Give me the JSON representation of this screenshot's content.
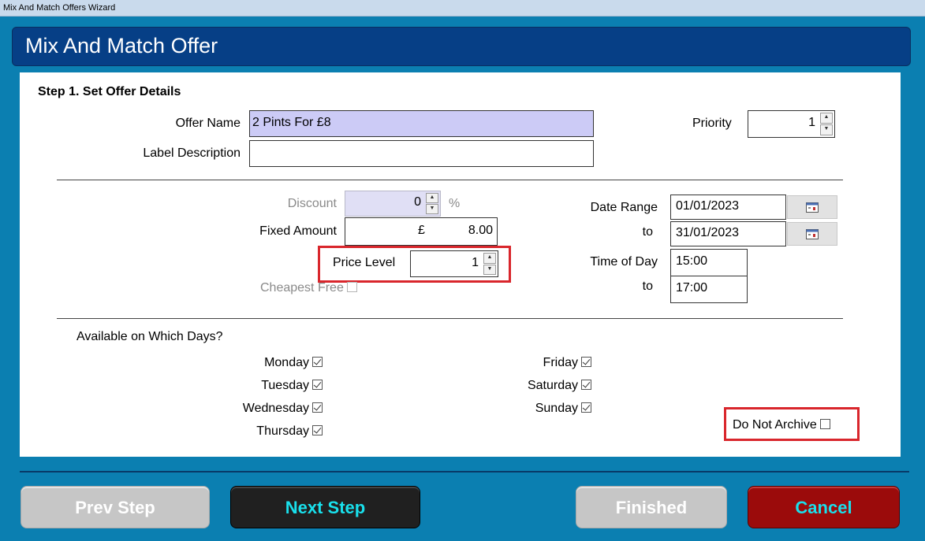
{
  "window": {
    "title": "Mix And Match Offers Wizard"
  },
  "header": {
    "title": "Mix And Match Offer"
  },
  "step": {
    "title": "Step 1.  Set Offer Details"
  },
  "offer_name": {
    "label": "Offer Name",
    "value": "2 Pints For £8"
  },
  "label_description": {
    "label": "Label Description",
    "value": ""
  },
  "priority": {
    "label": "Priority",
    "value": "1"
  },
  "discount": {
    "label": "Discount",
    "value": "0",
    "unit": "%"
  },
  "fixed_amount": {
    "label": "Fixed Amount",
    "currency": "£",
    "value": "8.00"
  },
  "price_level": {
    "label": "Price Level",
    "value": "1"
  },
  "cheapest_free": {
    "label": "Cheapest Free"
  },
  "date_range": {
    "label": "Date Range",
    "to_label": "to",
    "from": "01/01/2023",
    "to": "31/01/2023"
  },
  "time_of_day": {
    "label": "Time of Day",
    "to_label": "to",
    "from": "15:00",
    "to": "17:00"
  },
  "days": {
    "heading": "Available on Which Days?",
    "monday": "Monday",
    "tuesday": "Tuesday",
    "wednesday": "Wednesday",
    "thursday": "Thursday",
    "friday": "Friday",
    "saturday": "Saturday",
    "sunday": "Sunday"
  },
  "do_not_archive": {
    "label": "Do Not Archive"
  },
  "buttons": {
    "prev": "Prev Step",
    "next": "Next Step",
    "finished": "Finished",
    "cancel": "Cancel"
  },
  "colors": {
    "background": "#0b7fb1",
    "header": "#063f86",
    "highlight": "#d9262c",
    "button_text": "#19e0ec",
    "cancel": "#9b0b0b"
  }
}
